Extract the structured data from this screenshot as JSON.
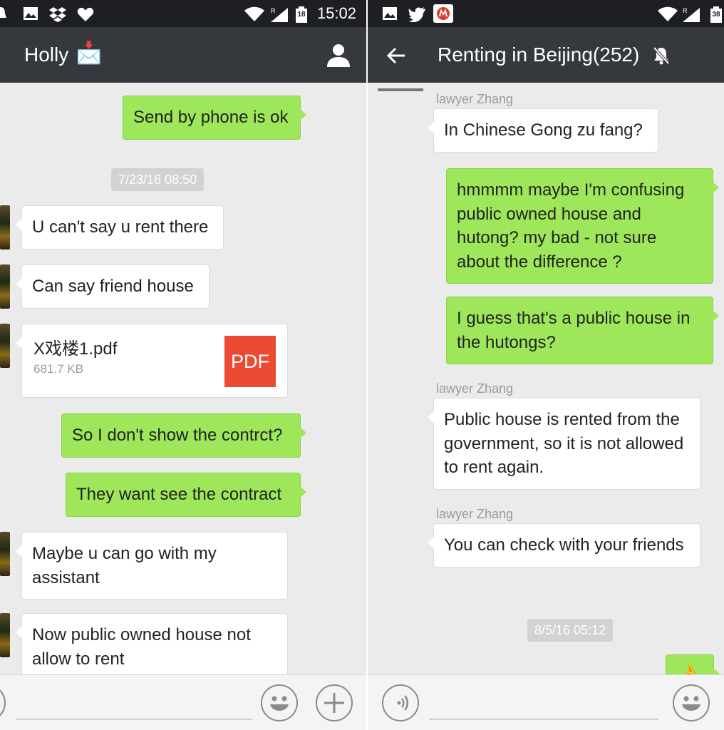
{
  "left": {
    "statusbar": {
      "time": "15:02",
      "battery_level": "18"
    },
    "title": "Holly",
    "title_icon": "📩",
    "messages": {
      "m1": "Send by phone is ok",
      "stamp1": "7/23/16 08:50",
      "m2": "U can't say u rent there",
      "m3": "Can say friend house",
      "file": {
        "name": "X戏楼1.pdf",
        "size": "681.7 KB",
        "badge": "PDF"
      },
      "m4": "So I don't show the contrct?",
      "m5": "They want see the contract",
      "m6": "Maybe u can go with my assistant",
      "m7": "Now public owned house not allow to rent"
    }
  },
  "right": {
    "statusbar": {
      "battery_level": "38"
    },
    "title": "Renting in Beijing(252)",
    "messages": {
      "sender1": "lawyer Zhang",
      "m1": "In Chinese Gong zu fang?",
      "m2": "hmmmm maybe I'm confusing public owned house and hutong? my bad - not sure about the difference ?",
      "m3": "I guess that's a public house in the hutongs?",
      "sender2": "lawyer Zhang",
      "m4": "Public house is rented from the government, so it is not allowed to rent again.",
      "sender3": "lawyer Zhang",
      "m5": "You can check with your friends",
      "stamp1": "8/5/16 05:12",
      "m6_emoji": "👌"
    }
  },
  "colors": {
    "incoming": "#ffffff",
    "outgoing": "#9ee75a",
    "titlebar": "#35383d",
    "statusbar": "#1d1f22",
    "pdf_badge": "#ec4b33"
  },
  "icons": [
    "image-icon",
    "dropbox-icon",
    "heart-icon",
    "wifi-icon",
    "signal-icon",
    "battery-icon",
    "twitter-icon",
    "app-badge-icon",
    "contact-icon",
    "back-arrow-icon",
    "mute-bell-icon",
    "emoji-icon",
    "plus-icon",
    "voice-icon"
  ]
}
